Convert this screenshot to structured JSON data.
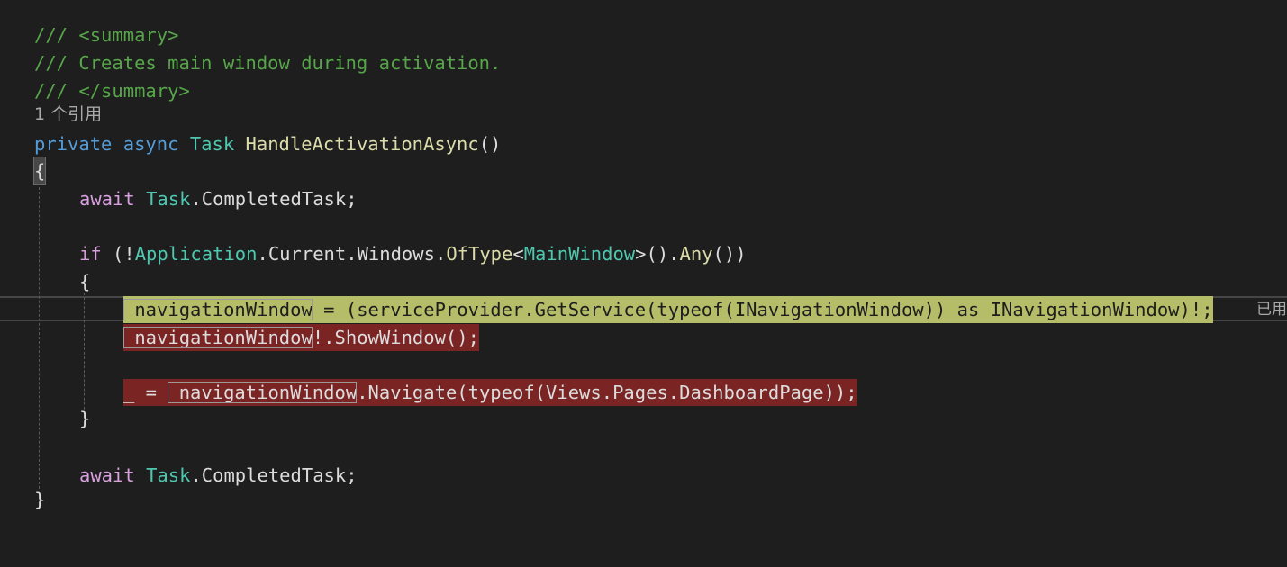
{
  "editor": {
    "lines": {
      "l1": "/// <summary>",
      "l2": "/// Creates main window during activation.",
      "l3": "/// </summary>",
      "codelens": "1 个引用",
      "sig_private": "private",
      "sig_async": "async",
      "sig_task": "Task",
      "sig_name": "HandleActivationAsync",
      "sig_parens": "()",
      "open_brace": "{",
      "await1_kw": "await",
      "await1_type": "Task",
      "await1_rest": ".CompletedTask;",
      "if_kw": "if",
      "if_open": " (!",
      "if_app": "Application",
      "if_chain": ".Current.Windows.",
      "if_oftype": "OfType",
      "if_lt": "<",
      "if_mainwindow": "MainWindow",
      "if_gt": ">().",
      "if_any": "Any",
      "if_close": "())",
      "inner_open": "{",
      "nav_var": "_navigationWindow",
      "assign_rest": " = (serviceProvider.GetService(typeof(INavigationWindow)) as INavigationWindow)!;",
      "show_var": "_navigationWindow",
      "show_rest": "!.ShowWindow();",
      "discard": "_ = ",
      "navigate_var": "_navigationWindow",
      "navigate_rest": ".Navigate(typeof(Views.Pages.DashboardPage));",
      "inner_close": "}",
      "await2_kw": "await",
      "await2_type": "Task",
      "await2_rest": ".CompletedTask;",
      "close_brace": "}"
    },
    "right_hint": "已用"
  },
  "colors": {
    "background": "#1e1e1e",
    "comment": "#57a64a",
    "keyword": "#569cd6",
    "control": "#d8a0df",
    "type": "#4ec9b0",
    "method": "#dcdcaa",
    "highlight_yellow": "#b5bd68",
    "highlight_red": "#7a2424"
  }
}
